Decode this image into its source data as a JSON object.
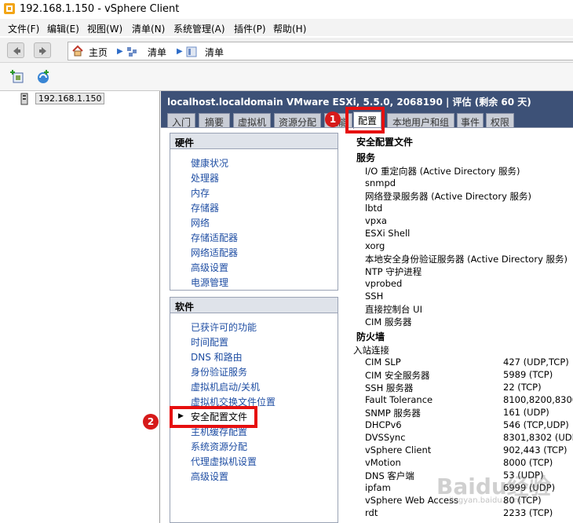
{
  "window": {
    "title": "192.168.1.150 - vSphere Client"
  },
  "menu": [
    "文件(F)",
    "编辑(E)",
    "视图(W)",
    "清单(N)",
    "系统管理(A)",
    "插件(P)",
    "帮助(H)"
  ],
  "breadcrumb": {
    "home": "主页",
    "inventory1": "清单",
    "inventory2": "清单"
  },
  "tree": {
    "host": "192.168.1.150"
  },
  "header": {
    "text": "localhost.localdomain VMware ESXi, 5.5.0, 2068190 | 评估 (剩余 60 天)"
  },
  "tabs": [
    "入门",
    "摘要",
    "虚拟机",
    "资源分配",
    "性能",
    "配置",
    "本地用户和组",
    "事件",
    "权限"
  ],
  "active_tab": "配置",
  "hardware": {
    "title": "硬件",
    "items": [
      "健康状况",
      "处理器",
      "内存",
      "存储器",
      "网络",
      "存储适配器",
      "网络适配器",
      "高级设置",
      "电源管理"
    ]
  },
  "software": {
    "title": "软件",
    "items": [
      "已获许可的功能",
      "时间配置",
      "DNS 和路由",
      "身份验证服务",
      "虚拟机启动/关机",
      "虚拟机交换文件位置",
      "安全配置文件",
      "主机缓存配置",
      "系统资源分配",
      "代理虚拟机设置",
      "高级设置"
    ],
    "selected": "安全配置文件"
  },
  "detail": {
    "title": "安全配置文件",
    "services_heading": "服务",
    "services": [
      "I/O 重定向器 (Active Directory 服务)",
      "snmpd",
      "网络登录服务器 (Active Directory 服务)",
      "lbtd",
      "vpxa",
      "ESXi Shell",
      "xorg",
      "本地安全身份验证服务器 (Active Directory 服务)",
      "NTP 守护进程",
      "vprobed",
      "SSH",
      "直接控制台 UI",
      "CIM 服务器"
    ],
    "firewall_heading": "防火墙",
    "incoming_label": "入站连接",
    "firewall": [
      {
        "name": "CIM SLP",
        "ports": "427 (UDP,TCP)"
      },
      {
        "name": "CIM 安全服务器",
        "ports": "5989 (TCP)"
      },
      {
        "name": "SSH 服务器",
        "ports": "22 (TCP)"
      },
      {
        "name": "Fault Tolerance",
        "ports": "8100,8200,8300 (TCP"
      },
      {
        "name": "SNMP 服务器",
        "ports": "161 (UDP)"
      },
      {
        "name": "DHCPv6",
        "ports": "546 (TCP,UDP)"
      },
      {
        "name": "DVSSync",
        "ports": "8301,8302 (UDP)"
      },
      {
        "name": "vSphere Client",
        "ports": "902,443 (TCP)"
      },
      {
        "name": "vMotion",
        "ports": "8000 (TCP)"
      },
      {
        "name": "DNS 客户端",
        "ports": "53 (UDP)"
      },
      {
        "name": "ipfam",
        "ports": "6999 (UDP)"
      },
      {
        "name": "vSphere Web Access",
        "ports": "80 (TCP)"
      },
      {
        "name": "rdt",
        "ports": "2233 (TCP)"
      }
    ]
  },
  "annotations": {
    "badge1": "1",
    "badge2": "2"
  },
  "watermark": {
    "main": "Baidu经验",
    "sub": "jingyan.baidu.com"
  },
  "colors": {
    "header_bg": "#3d5177",
    "link": "#1f4ea3",
    "annotation": "#e60f0f"
  }
}
